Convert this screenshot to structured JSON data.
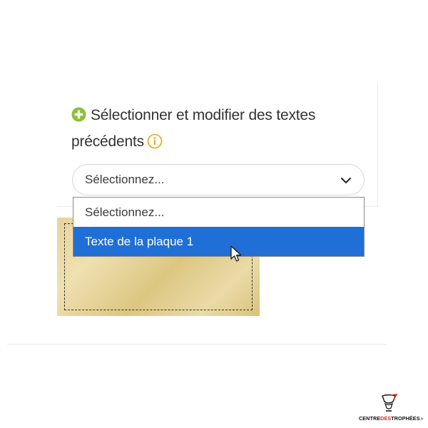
{
  "section": {
    "title": "Sélectionner et modifier des textes précédents",
    "add_icon": "plus-circle-icon",
    "info_icon": "info-icon"
  },
  "select": {
    "value": "Sélectionnez...",
    "chevron_icon": "chevron-down-icon"
  },
  "dropdown": {
    "options": [
      {
        "label": "Sélectionnez...",
        "highlighted": false
      },
      {
        "label": "Texte de la plaque 1",
        "highlighted": true
      }
    ]
  },
  "logo": {
    "part1": "CENTRE",
    "part2": "DES",
    "part3": "TROPHÉES",
    "tld": ".fr"
  },
  "colors": {
    "accent_green": "#8cbf3a",
    "info_orange": "#e8a317",
    "highlight_blue": "#1f6fd6",
    "logo_red": "#d52b1e"
  }
}
